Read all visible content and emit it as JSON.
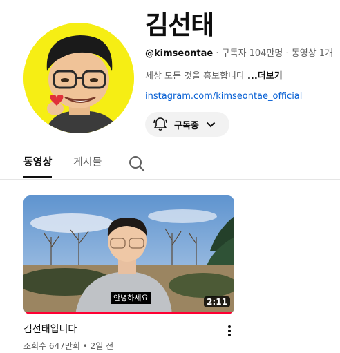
{
  "channel": {
    "name": "김선태",
    "handle": "@kimseontae",
    "subscribers": "구독자 104만명",
    "videos": "동영상 1개",
    "separator": " · ",
    "description": "세상 모든 것을 홍보합니다",
    "more_label": "...더보기",
    "link": "instagram.com/kimseontae_official",
    "subscribe_label": "구독중",
    "avatar_bg": "#f6ee14"
  },
  "tabs": [
    {
      "label": "동영상",
      "active": true
    },
    {
      "label": "게시물",
      "active": false
    }
  ],
  "search_icon": "search-icon",
  "video": {
    "title": "김선태입니다",
    "views": "조회수 647만회",
    "age": "2일 전",
    "meta_separator": " • ",
    "duration": "2:11",
    "caption": "안녕하세요",
    "progress_fraction": 1.0,
    "progress_color": "#ff0033"
  }
}
